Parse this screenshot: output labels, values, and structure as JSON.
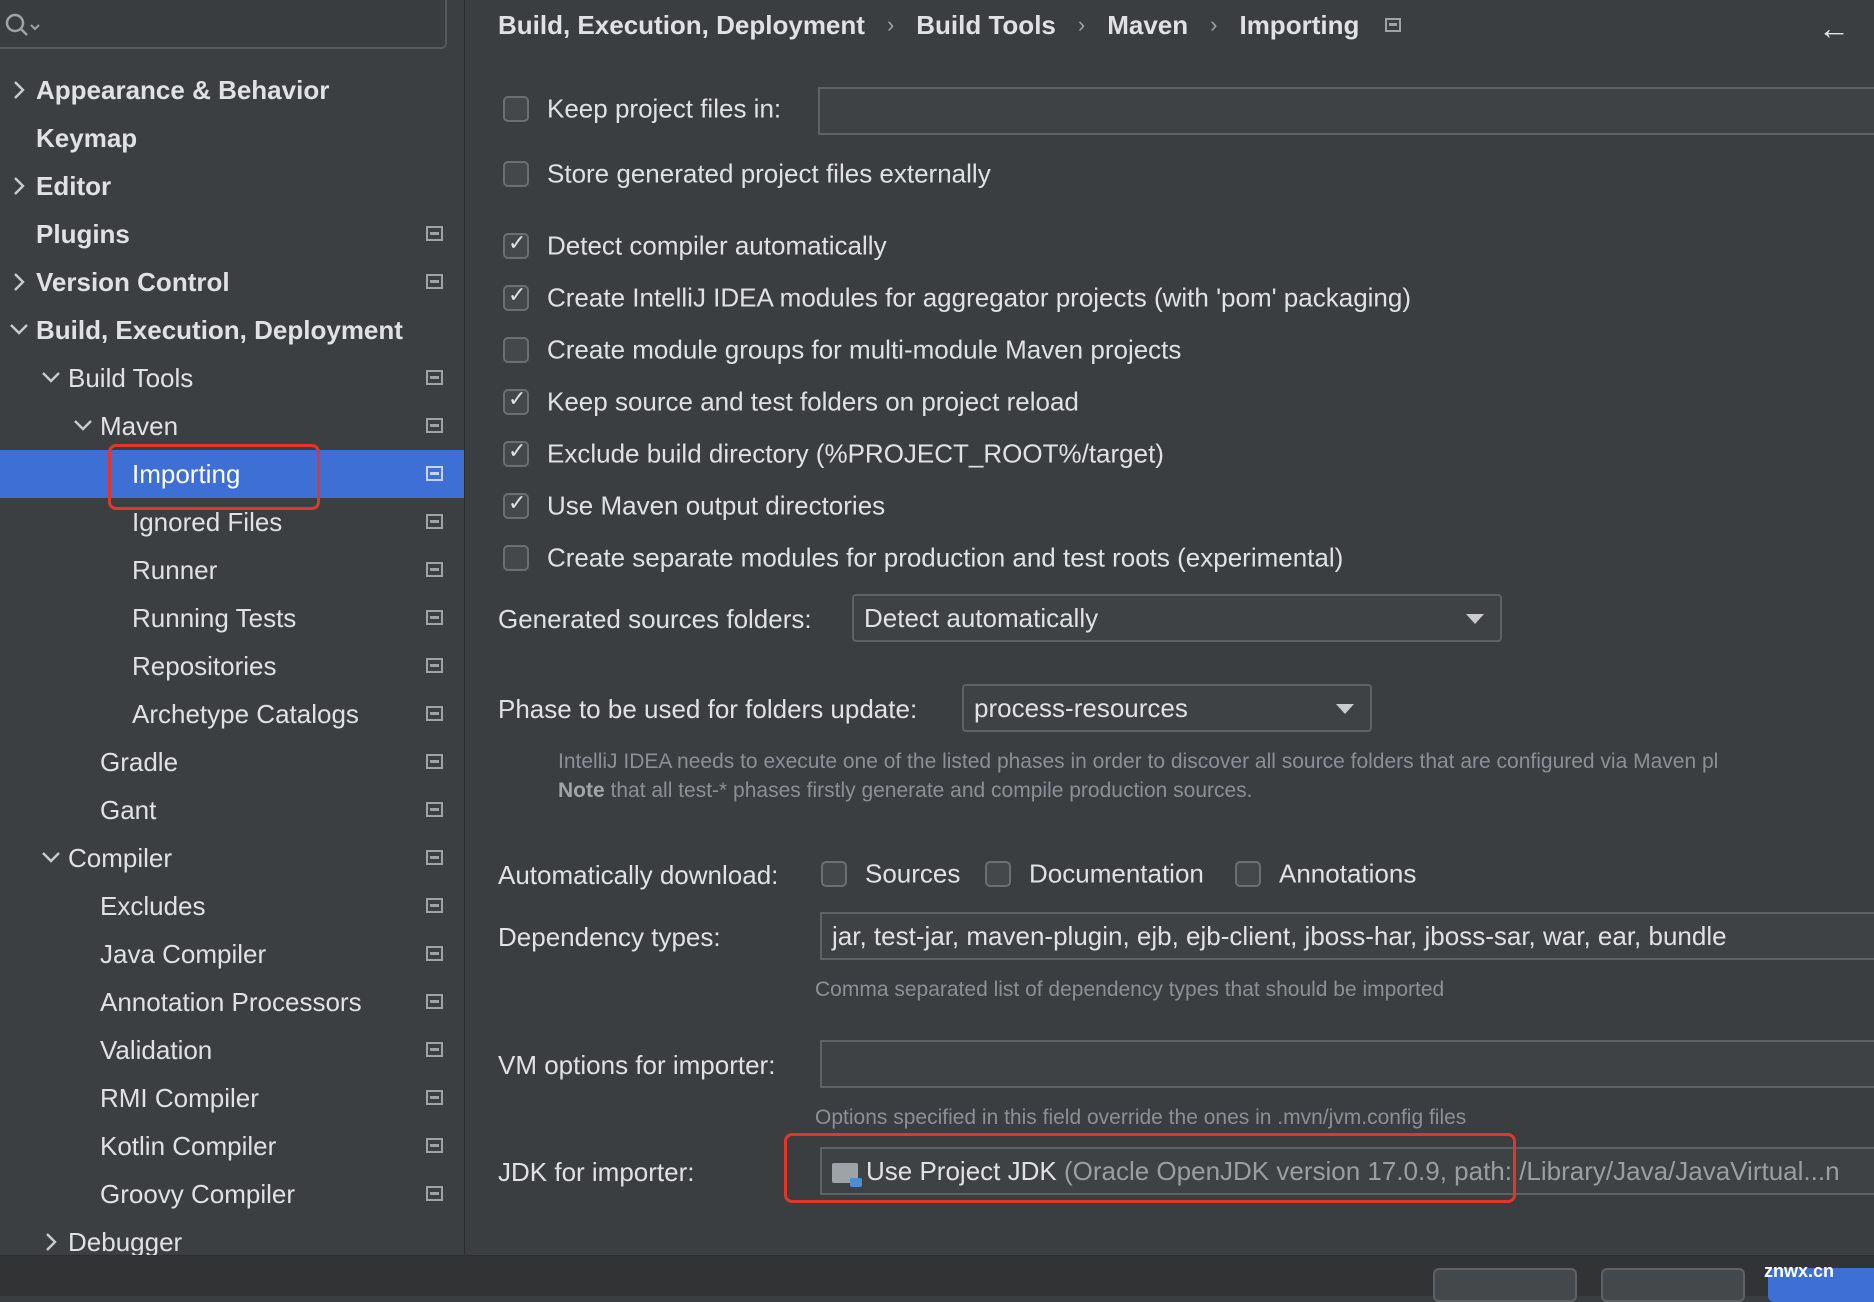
{
  "sidebar": {
    "items": [
      {
        "label": "Appearance & Behavior",
        "chevron": "right",
        "bold": true,
        "proj": false
      },
      {
        "label": "Keymap",
        "chevron": "none",
        "bold": true,
        "proj": false
      },
      {
        "label": "Editor",
        "chevron": "right",
        "bold": true,
        "proj": false
      },
      {
        "label": "Plugins",
        "chevron": "none",
        "bold": true,
        "proj": true
      },
      {
        "label": "Version Control",
        "chevron": "right",
        "bold": true,
        "proj": true
      },
      {
        "label": "Build, Execution, Deployment",
        "chevron": "down",
        "bold": true,
        "proj": false
      },
      {
        "label": "Build Tools",
        "chevron": "down",
        "bold": false,
        "proj": true
      },
      {
        "label": "Maven",
        "chevron": "down",
        "bold": false,
        "proj": true
      },
      {
        "label": "Importing",
        "chevron": "none",
        "bold": false,
        "proj": true,
        "selected": true
      },
      {
        "label": "Ignored Files",
        "chevron": "none",
        "bold": false,
        "proj": true
      },
      {
        "label": "Runner",
        "chevron": "none",
        "bold": false,
        "proj": true
      },
      {
        "label": "Running Tests",
        "chevron": "none",
        "bold": false,
        "proj": true
      },
      {
        "label": "Repositories",
        "chevron": "none",
        "bold": false,
        "proj": true
      },
      {
        "label": "Archetype Catalogs",
        "chevron": "none",
        "bold": false,
        "proj": true
      },
      {
        "label": "Gradle",
        "chevron": "none",
        "bold": false,
        "proj": true
      },
      {
        "label": "Gant",
        "chevron": "none",
        "bold": false,
        "proj": true
      },
      {
        "label": "Compiler",
        "chevron": "down",
        "bold": false,
        "proj": true
      },
      {
        "label": "Excludes",
        "chevron": "none",
        "bold": false,
        "proj": true
      },
      {
        "label": "Java Compiler",
        "chevron": "none",
        "bold": false,
        "proj": true
      },
      {
        "label": "Annotation Processors",
        "chevron": "none",
        "bold": false,
        "proj": true
      },
      {
        "label": "Validation",
        "chevron": "none",
        "bold": false,
        "proj": true
      },
      {
        "label": "RMI Compiler",
        "chevron": "none",
        "bold": false,
        "proj": true
      },
      {
        "label": "Kotlin Compiler",
        "chevron": "none",
        "bold": false,
        "proj": true
      },
      {
        "label": "Groovy Compiler",
        "chevron": "none",
        "bold": false,
        "proj": true
      },
      {
        "label": "Debugger",
        "chevron": "right",
        "bold": false,
        "proj": false
      }
    ]
  },
  "breadcrumb": [
    "Build, Execution, Deployment",
    "Build Tools",
    "Maven",
    "Importing"
  ],
  "settings": {
    "keep_project_files": {
      "label": "Keep project files in:",
      "checked": false,
      "value": ""
    },
    "store_external": {
      "label": "Store generated project files externally",
      "checked": false
    },
    "detect_compiler": {
      "label": "Detect compiler automatically",
      "checked": true
    },
    "create_modules_aggregator": {
      "label": "Create IntelliJ IDEA modules for aggregator projects (with 'pom' packaging)",
      "checked": true
    },
    "module_groups": {
      "label": "Create module groups for multi-module Maven projects",
      "checked": false
    },
    "keep_source_folders": {
      "label": "Keep source and test folders on project reload",
      "checked": true
    },
    "exclude_build_dir": {
      "label": "Exclude build directory (%PROJECT_ROOT%/target)",
      "checked": true
    },
    "use_maven_output": {
      "label": "Use Maven output directories",
      "checked": true
    },
    "separate_modules": {
      "label": "Create separate modules for production and test roots (experimental)",
      "checked": false
    },
    "generated_sources": {
      "label": "Generated sources folders:",
      "value": "Detect automatically"
    },
    "phase": {
      "label": "Phase to be used for folders update:",
      "value": "process-resources"
    },
    "phase_hint_line1": "IntelliJ IDEA needs to execute one of the listed phases in order to discover all source folders that are configured via Maven pl",
    "phase_hint_note": "Note",
    "phase_hint_line2": " that all test-* phases firstly generate and compile production sources.",
    "auto_download": {
      "label": "Automatically download:",
      "sources": {
        "label": "Sources",
        "checked": false
      },
      "documentation": {
        "label": "Documentation",
        "checked": false
      },
      "annotations": {
        "label": "Annotations",
        "checked": false
      }
    },
    "dependency_types": {
      "label": "Dependency types:",
      "value": "jar, test-jar, maven-plugin, ejb, ejb-client, jboss-har, jboss-sar, war, ear, bundle",
      "hint": "Comma separated list of dependency types that should be imported"
    },
    "vm_options": {
      "label": "VM options for importer:",
      "value": "",
      "hint": "Options specified in this field override the ones in .mvn/jvm.config files"
    },
    "jdk": {
      "label": "JDK for importer:",
      "value": "Use Project JDK",
      "detail": "(Oracle OpenJDK version 17.0.9, path: /Library/Java/JavaVirtual...n"
    }
  },
  "watermark": "znwx.cn",
  "colors": {
    "selection": "#3d6fd4",
    "highlight": "#e0372a",
    "background": "#3b3e41"
  }
}
